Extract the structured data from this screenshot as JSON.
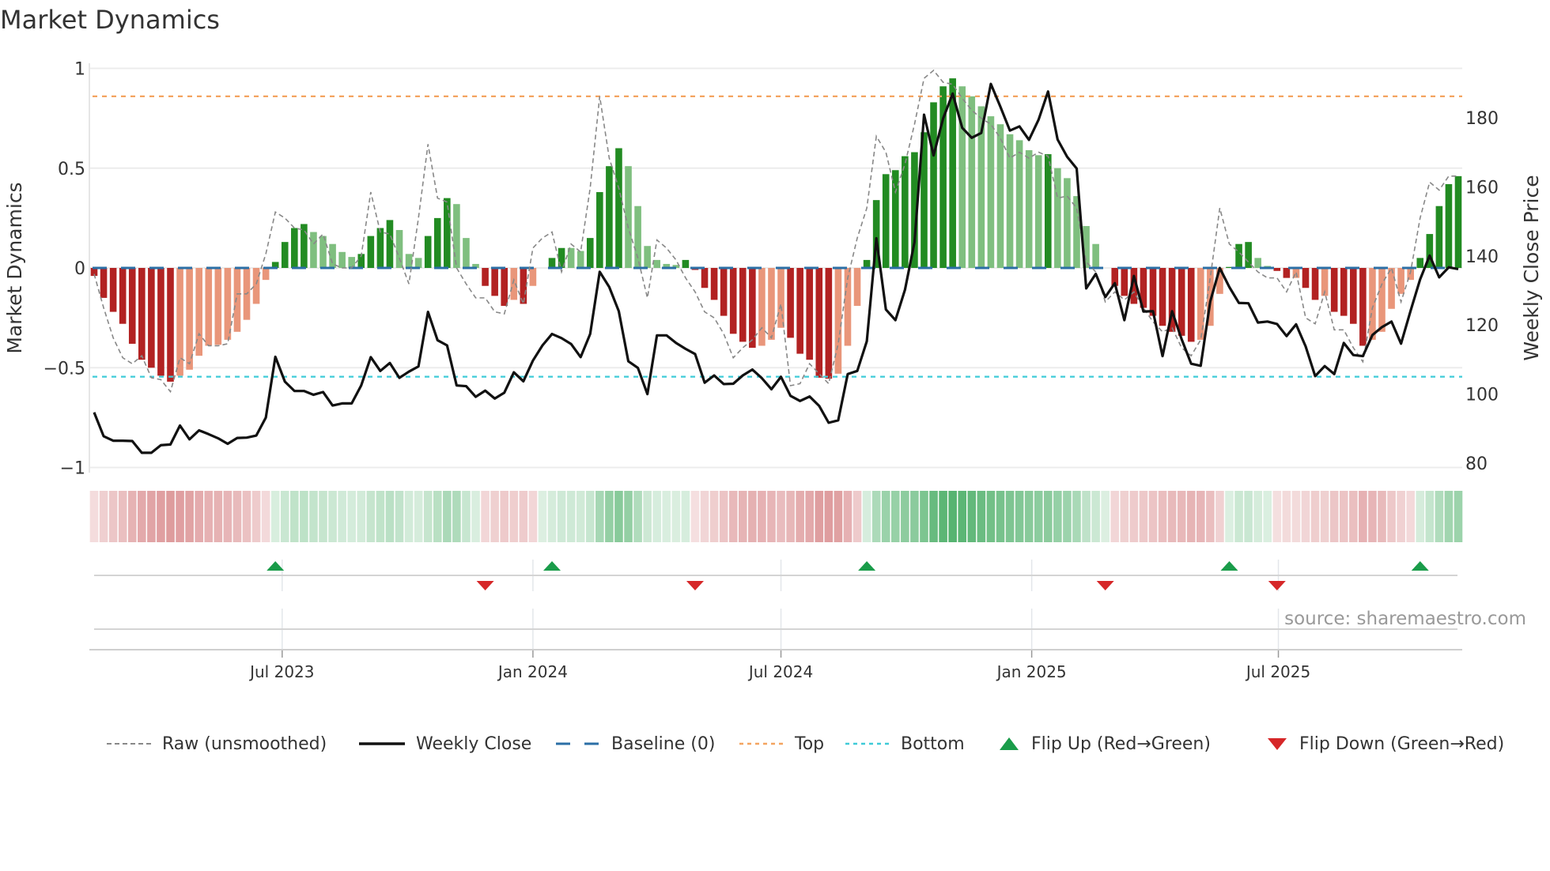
{
  "title": "Market Dynamics",
  "source": "source: sharemaestro.com",
  "legend": [
    {
      "label": "Raw (unsmoothed)",
      "icon": "dashed-gray-line"
    },
    {
      "label": "Weekly Close",
      "icon": "solid-black-line"
    },
    {
      "label": "Baseline (0)",
      "icon": "dashed-blue-line"
    },
    {
      "label": "Top",
      "icon": "dotted-orange-line"
    },
    {
      "label": "Bottom",
      "icon": "dotted-cyan-line"
    },
    {
      "label": "Flip Up (Red→Green)",
      "icon": "triangle-up-icon"
    },
    {
      "label": "Flip Down (Green→Red)",
      "icon": "triangle-down-icon"
    }
  ],
  "colors": {
    "dark_green": "#228b22",
    "light_green": "#7fbf7f",
    "dark_red": "#b22222",
    "light_red": "#e9967a",
    "raw": "#888888",
    "price": "#111111",
    "baseline": "#2b6fa6",
    "top": "#f4a460",
    "bottom": "#3fcbd8",
    "flip_up": "#1a9c4a",
    "flip_down": "#d62728",
    "strip_green": "#3ca85a",
    "strip_red": "#c8575a"
  },
  "chart_data": {
    "type": "bar",
    "title": "Market Dynamics",
    "xlabel": "",
    "ylabel": "Market Dynamics",
    "y2label": "Weekly Close Price",
    "ylim": [
      -1,
      1
    ],
    "y2lim": [
      78.6,
      194.2
    ],
    "yticks": [
      {
        "v": 1,
        "label": "1"
      },
      {
        "v": 0.5,
        "label": "0.5"
      },
      {
        "v": 0,
        "label": "0"
      },
      {
        "v": -0.5,
        "label": "−0.5"
      },
      {
        "v": -1,
        "label": "−1"
      }
    ],
    "y2ticks": [
      {
        "v": 180,
        "label": "180"
      },
      {
        "v": 160,
        "label": "160"
      },
      {
        "v": 140,
        "label": "140"
      },
      {
        "v": 120,
        "label": "120"
      },
      {
        "v": 100,
        "label": "100"
      },
      {
        "v": 80,
        "label": "80"
      }
    ],
    "xticks": [
      {
        "date": "2023-07-01",
        "label": "Jul 2023"
      },
      {
        "date": "2024-01-01",
        "label": "Jan 2024"
      },
      {
        "date": "2024-07-01",
        "label": "Jul 2024"
      },
      {
        "date": "2025-01-01",
        "label": "Jan 2025"
      },
      {
        "date": "2025-07-01",
        "label": "Jul 2025"
      }
    ],
    "x_start": "2023-02-13",
    "x_step_days": 7,
    "grid": true,
    "legend_position": "bottom",
    "levels": {
      "baseline": 0,
      "top": 0.86,
      "bottom": -0.545
    },
    "dynamics": [
      -0.04,
      -0.15,
      -0.22,
      -0.28,
      -0.38,
      -0.46,
      -0.5,
      -0.54,
      -0.57,
      -0.54,
      -0.51,
      -0.44,
      -0.39,
      -0.385,
      -0.36,
      -0.32,
      -0.26,
      -0.18,
      -0.06,
      0.03,
      0.13,
      0.2,
      0.22,
      0.18,
      0.16,
      0.12,
      0.08,
      0.055,
      0.07,
      0.16,
      0.2,
      0.24,
      0.19,
      0.07,
      0.05,
      0.16,
      0.25,
      0.35,
      0.32,
      0.15,
      0.02,
      -0.09,
      -0.14,
      -0.19,
      -0.16,
      -0.18,
      -0.09,
      0.0,
      0.05,
      0.1,
      0.1,
      0.085,
      0.15,
      0.38,
      0.51,
      0.6,
      0.51,
      0.31,
      0.11,
      0.04,
      0.02,
      0.015,
      0.04,
      -0.01,
      -0.1,
      -0.16,
      -0.24,
      -0.33,
      -0.37,
      -0.4,
      -0.39,
      -0.36,
      -0.3,
      -0.35,
      -0.43,
      -0.46,
      -0.55,
      -0.555,
      -0.53,
      -0.39,
      -0.19,
      0.04,
      0.34,
      0.47,
      0.49,
      0.56,
      0.58,
      0.68,
      0.83,
      0.91,
      0.95,
      0.91,
      0.86,
      0.81,
      0.76,
      0.72,
      0.67,
      0.64,
      0.59,
      0.565,
      0.57,
      0.5,
      0.45,
      0.36,
      0.21,
      0.12,
      0.0,
      -0.09,
      -0.14,
      -0.18,
      -0.2,
      -0.24,
      -0.29,
      -0.32,
      -0.34,
      -0.37,
      -0.36,
      -0.29,
      -0.13,
      0.005,
      0.12,
      0.13,
      0.05,
      0.01,
      -0.015,
      -0.05,
      -0.05,
      -0.1,
      -0.16,
      -0.14,
      -0.22,
      -0.24,
      -0.28,
      -0.39,
      -0.36,
      -0.32,
      -0.205,
      -0.13,
      -0.06,
      0.05,
      0.17,
      0.31,
      0.42,
      0.46
    ],
    "raw": [
      -0.03,
      -0.2,
      -0.35,
      -0.45,
      -0.48,
      -0.44,
      -0.55,
      -0.56,
      -0.62,
      -0.45,
      -0.48,
      -0.33,
      -0.39,
      -0.39,
      -0.38,
      -0.13,
      -0.13,
      -0.08,
      0.07,
      0.28,
      0.25,
      0.2,
      0.19,
      0.12,
      0.17,
      0.02,
      0.0,
      0.0,
      0.06,
      0.38,
      0.18,
      0.17,
      0.05,
      -0.08,
      0.25,
      0.62,
      0.35,
      0.33,
      0.0,
      -0.08,
      -0.15,
      -0.15,
      -0.22,
      -0.23,
      -0.06,
      -0.18,
      0.1,
      0.15,
      0.18,
      -0.02,
      0.12,
      0.08,
      0.4,
      0.86,
      0.55,
      0.4,
      0.2,
      0.05,
      -0.15,
      0.14,
      0.1,
      0.04,
      -0.05,
      -0.12,
      -0.22,
      -0.25,
      -0.33,
      -0.45,
      -0.4,
      -0.36,
      -0.3,
      -0.35,
      -0.18,
      -0.59,
      -0.58,
      -0.48,
      -0.53,
      -0.58,
      -0.38,
      -0.05,
      0.15,
      0.3,
      0.66,
      0.58,
      0.38,
      0.52,
      0.72,
      0.95,
      0.99,
      0.93,
      0.92,
      0.85,
      0.79,
      0.75,
      0.72,
      0.65,
      0.55,
      0.58,
      0.55,
      0.58,
      0.56,
      0.35,
      0.36,
      0.3,
      0.03,
      -0.02,
      -0.17,
      -0.12,
      -0.16,
      -0.12,
      -0.2,
      -0.27,
      -0.32,
      -0.3,
      -0.4,
      -0.44,
      -0.36,
      -0.05,
      0.3,
      0.12,
      0.08,
      0.03,
      -0.02,
      -0.05,
      -0.05,
      -0.12,
      -0.02,
      -0.25,
      -0.28,
      -0.12,
      -0.31,
      -0.31,
      -0.4,
      -0.47,
      -0.2,
      -0.08,
      0.0,
      -0.17,
      -0.02,
      0.25,
      0.43,
      0.39,
      0.46,
      0.46
    ],
    "weekly_close": [
      94.7,
      87.8,
      86.5,
      86.5,
      86.4,
      83.0,
      83.0,
      85.2,
      85.4,
      90.9,
      86.9,
      89.5,
      88.4,
      87.2,
      85.6,
      87.3,
      87.4,
      88.0,
      93.2,
      110.8,
      103.6,
      100.9,
      100.9,
      99.8,
      100.6,
      96.7,
      97.3,
      97.3,
      102.5,
      110.7,
      106.7,
      109.0,
      104.7,
      106.5,
      108.0,
      123.8,
      115.6,
      114.1,
      102.5,
      102.3,
      99.2,
      101.0,
      98.7,
      100.4,
      106.3,
      103.7,
      109.7,
      114.1,
      117.4,
      116.2,
      114.5,
      110.7,
      117.4,
      135.4,
      131.0,
      124.0,
      109.5,
      107.6,
      100.0,
      117.0,
      117.0,
      114.8,
      113.1,
      111.6,
      103.3,
      105.4,
      102.9,
      103.0,
      105.4,
      107.1,
      104.6,
      101.4,
      105.0,
      99.5,
      98.0,
      99.3,
      96.6,
      91.7,
      92.4,
      105.8,
      106.7,
      115.3,
      145.1,
      124.5,
      121.4,
      130.2,
      144.0,
      180.9,
      169.1,
      179.8,
      187.0,
      177.1,
      174.2,
      175.6,
      189.8,
      183.2,
      176.3,
      177.5,
      173.6,
      179.4,
      187.6,
      173.7,
      168.7,
      165.3,
      130.6,
      134.8,
      128.1,
      132.1,
      121.4,
      134.2,
      123.9,
      124.0,
      111.0,
      124.0,
      115.9,
      108.8,
      108.2,
      126.8,
      136.5,
      131.0,
      126.4,
      126.3,
      120.7,
      121.0,
      120.3,
      116.8,
      120.2,
      113.8,
      105.2,
      108.1,
      105.8,
      114.8,
      111.3,
      111.0,
      117.1,
      119.4,
      121.0,
      114.6,
      124.1,
      133.2,
      140.1,
      133.8,
      136.7,
      136.2
    ],
    "flip_up_weeks": [
      19,
      48,
      81,
      119,
      139
    ],
    "flip_down_weeks": [
      41,
      63,
      106,
      124
    ]
  }
}
